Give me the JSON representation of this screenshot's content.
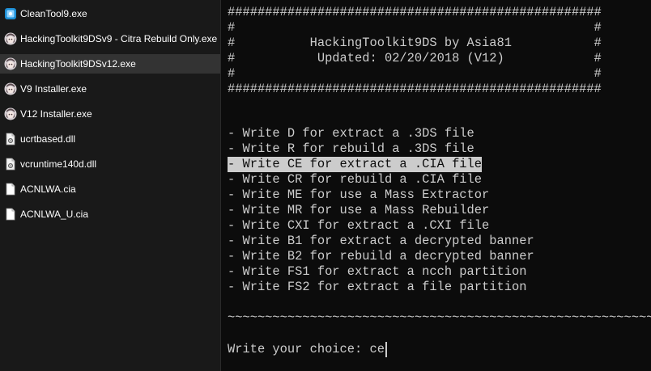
{
  "file_list": {
    "files": [
      {
        "name": "CleanTool9.exe",
        "icon": "cleantool-app-icon",
        "selected": false
      },
      {
        "name": "HackingToolkit9DSv9 - Citra Rebuild Only.exe",
        "icon": "toolkit-app-icon",
        "selected": false
      },
      {
        "name": "HackingToolkit9DSv12.exe",
        "icon": "toolkit-app-icon",
        "selected": true
      },
      {
        "name": "V9 Installer.exe",
        "icon": "toolkit-app-icon",
        "selected": false
      },
      {
        "name": "V12 Installer.exe",
        "icon": "toolkit-app-icon",
        "selected": false
      },
      {
        "name": "ucrtbased.dll",
        "icon": "dll-file-icon",
        "selected": false
      },
      {
        "name": "vcruntime140d.dll",
        "icon": "dll-file-icon",
        "selected": false
      },
      {
        "name": "ACNLWA.cia",
        "icon": "document-file-icon",
        "selected": false
      },
      {
        "name": "ACNLWA_U.cia",
        "icon": "document-file-icon",
        "selected": false
      }
    ]
  },
  "console": {
    "banner": [
      "##################################################",
      "#                                                #",
      "#          HackingToolkit9DS by Asia81           #",
      "#           Updated: 02/20/2018 (V12)            #",
      "#                                                #",
      "##################################################"
    ],
    "menu": [
      "- Write D for extract a .3DS file",
      "- Write R for rebuild a .3DS file",
      "- Write CE for extract a .CIA file",
      "- Write CR for rebuild a .CIA file",
      "- Write ME for use a Mass Extractor",
      "- Write MR for use a Mass Rebuilder",
      "- Write CXI for extract a .CXI file",
      "- Write B1 for extract a decrypted banner",
      "- Write B2 for rebuild a decrypted banner",
      "- Write FS1 for extract a ncch partition",
      "- Write FS2 for extract a file partition"
    ],
    "highlighted_index": 2,
    "separator": "~~~~~~~~~~~~~~~~~~~~~~~~~~~~~~~~~~~~~~~~~~~~~~~~~~~~~~~~~~",
    "prompt": "Write your choice: ",
    "input_value": "ce"
  },
  "colors": {
    "console_bg": "#0c0c0c",
    "console_text": "#cccccc",
    "panel_bg": "#191919",
    "selected_row": "#333333"
  }
}
